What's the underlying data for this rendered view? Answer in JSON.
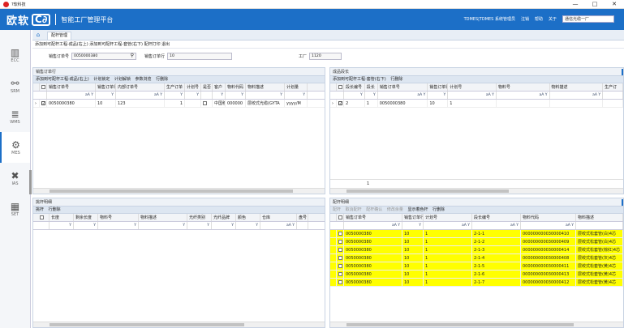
{
  "window": {
    "title": "?软科技",
    "min": "—",
    "max": "□",
    "close": "✕"
  },
  "header": {
    "logo": "欧软",
    "logo2": "C∂",
    "platform": "智能工厂管理平台",
    "user": "TDMES|TDMES 系统管理员",
    "logout": "注销",
    "help": "帮助",
    "about": "关于",
    "factory": "通信光缆一厂"
  },
  "tabs": {
    "home": "⌂",
    "current": "配杆管理"
  },
  "sidebar": [
    {
      "label": "ECC",
      "glyph": "▥"
    },
    {
      "label": "SRM",
      "glyph": "⚯"
    },
    {
      "label": "WMS",
      "glyph": "≣"
    },
    {
      "label": "MES",
      "glyph": "⚙"
    },
    {
      "label": "IAS",
      "glyph": "✖"
    },
    {
      "label": "SET",
      "glyph": "▦"
    }
  ],
  "toolbar": {
    "text": "添加到可配杆工程-成品(右上) 添加到可配杆工程-套管(右下) 配杆打印 退出"
  },
  "form": {
    "order_label": "销售订单号",
    "order_value": "0050000380",
    "line_label": "销售订单行",
    "line_value": "10",
    "factory_label": "工厂",
    "factory_value": "1120"
  },
  "panel_tl": {
    "title": "销售订单行",
    "tools": [
      "添加到可配杆工程-成品(右上)",
      "计划锁定",
      "计划解锁",
      "参数浏览",
      "行删除"
    ],
    "headers": [
      "",
      "",
      "销售订单号",
      "销售订单行",
      "内部订单号",
      "生产订单",
      "计划号",
      "是否",
      "客户",
      "物料代码",
      "物料描述",
      "计划量"
    ],
    "row": [
      "0050000380",
      "10",
      "123",
      "1",
      "中国移动",
      "000000",
      "层绞式光缆(GYTA",
      "yyyy/M"
    ]
  },
  "panel_tr": {
    "title": "成品段长",
    "tools": [
      "添加到可配杆工程-套管(右下)",
      "行删除"
    ],
    "headers": [
      "",
      "",
      "段长编号",
      "段长",
      "销售订单号",
      "销售订单行",
      "计划号",
      "物料号",
      "物料描述",
      "生产订"
    ],
    "row": [
      "2",
      "1",
      "0050000380",
      "10",
      "1"
    ],
    "footer_val": "1"
  },
  "panel_bl": {
    "title": "挑杆明细",
    "tools": [
      "挑杆",
      "行删除"
    ],
    "headers": [
      "",
      "长度",
      "剩余长度",
      "物料号",
      "物料描述",
      "光纤类别",
      "光纤品牌",
      "颜色",
      "仓库",
      "盘号"
    ]
  },
  "panel_br": {
    "title": "配杆明细",
    "tools": [
      "配杆",
      "取消配杆",
      "配杆确认",
      "修改余量",
      "显示着色杆",
      "行删除"
    ],
    "headers": [
      "",
      "",
      "销售订单号",
      "销售订单行",
      "计划号",
      "段长编号",
      "物料代码",
      "物料描述"
    ],
    "rows": [
      [
        "0050000380",
        "10",
        "1",
        "2-1-1",
        "000000000030000410",
        "层绞式松套管(白)4芯"
      ],
      [
        "0050000380",
        "10",
        "1",
        "2-1-2",
        "000000000030000409",
        "层绞式松套管(白)4芯"
      ],
      [
        "0050000380",
        "10",
        "1",
        "2-1-3",
        "000000000030000414",
        "层绞式松套管(棕红)4芯"
      ],
      [
        "0050000380",
        "10",
        "1",
        "2-1-4",
        "000000000030000408",
        "层绞式松套管(灰)4芯"
      ],
      [
        "0050000380",
        "10",
        "1",
        "2-1-5",
        "000000000030000411",
        "层绞式松套管(黄)4芯"
      ],
      [
        "0050000380",
        "10",
        "1",
        "2-1-6",
        "000000000030000413",
        "层绞式松套管(黄)4芯"
      ],
      [
        "0050000380",
        "10",
        "1",
        "2-1-7",
        "000000000030000412",
        "层绞式松套管(黄)4芯"
      ]
    ]
  },
  "filter_glyphs": {
    "aa": "aA",
    "funnel": "Y"
  },
  "colors": {
    "brand": "#1c6fc7",
    "highlight": "#ffff00"
  }
}
